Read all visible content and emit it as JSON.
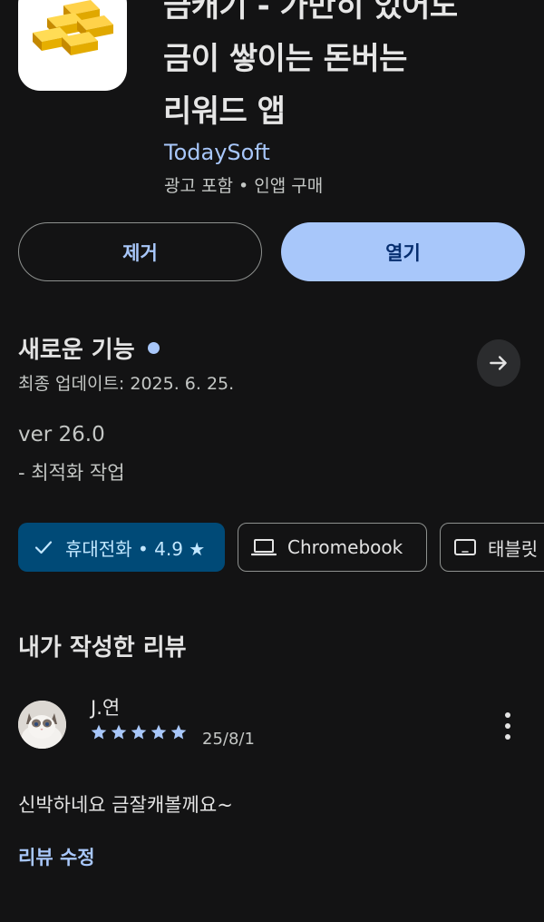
{
  "app": {
    "icon": "gold-bars-icon",
    "title_lines": [
      "금캐기 - 가만히 있어도",
      "금이 쌓이는 돈버는",
      "리워드 앱"
    ],
    "developer": "TodaySoft",
    "meta": "광고 포함 • 인앱 구매"
  },
  "actions": {
    "remove_label": "제거",
    "open_label": "열기"
  },
  "whats_new": {
    "title": "새로운 기능",
    "updated": "최종 업데이트: 2025. 6. 25.",
    "version": "ver 26.0",
    "note": "- 최적화 작업",
    "arrow_icon": "arrow-right-icon"
  },
  "device_chips": [
    {
      "label": "휴대전화 • 4.9 ★",
      "icon": "check-icon",
      "selected": true
    },
    {
      "label": "Chromebook",
      "icon": "laptop-icon",
      "selected": false
    },
    {
      "label": "태블릿",
      "icon": "tablet-icon",
      "selected": false
    }
  ],
  "my_review": {
    "heading": "내가 작성한 리뷰",
    "reviewer": "J.연",
    "rating": 5,
    "date": "25/8/1",
    "text": "신박하네요 금잘캐볼께요~",
    "edit_label": "리뷰 수정"
  },
  "colors": {
    "background": "#131314",
    "accent": "#a8c7fa",
    "chip_selected": "#004a77"
  }
}
